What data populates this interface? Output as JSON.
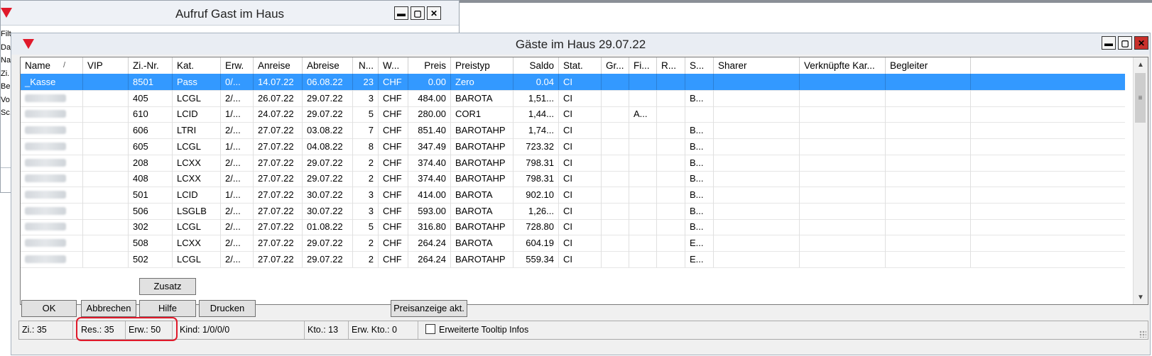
{
  "background_window": {
    "title": "Aufruf Gast im Haus",
    "side_labels": [
      "Filt",
      "Da",
      "Na",
      "Zi.",
      "Be",
      "Vo",
      "Sc."
    ]
  },
  "main_window": {
    "title": "Gäste im Haus 29.07.22"
  },
  "grid": {
    "columns": [
      "Name",
      "VIP",
      "Zi.-Nr.",
      "Kat.",
      "Erw.",
      "Anreise",
      "Abreise",
      "N...",
      "W...",
      "Preis",
      "Preistyp",
      "Saldo",
      "Stat.",
      "Gr...",
      "Fi...",
      "R...",
      "S...",
      "Sharer",
      "Verknüpfte Kar...",
      "Begleiter"
    ],
    "sort_indicator": "/",
    "rows": [
      {
        "name": "_Kasse",
        "vip": "",
        "zi": "8501",
        "kat": "Pass",
        "erw": "0/...",
        "anreise": "14.07.22",
        "abreise": "06.08.22",
        "n": "23",
        "w": "CHF",
        "preis": "0.00",
        "preistyp": "Zero",
        "saldo": "0.04",
        "stat": "CI",
        "gr": "",
        "fi": "",
        "r": "",
        "s": "",
        "selected": true
      },
      {
        "name": "",
        "vip": "",
        "zi": "405",
        "kat": "LCGL",
        "erw": "2/...",
        "anreise": "26.07.22",
        "abreise": "29.07.22",
        "n": "3",
        "w": "CHF",
        "preis": "484.00",
        "preistyp": "BAROTA",
        "saldo": "1,51...",
        "stat": "CI",
        "gr": "",
        "fi": "",
        "r": "",
        "s": "B..."
      },
      {
        "name": "",
        "vip": "",
        "zi": "610",
        "kat": "LCID",
        "erw": "1/...",
        "anreise": "24.07.22",
        "abreise": "29.07.22",
        "n": "5",
        "w": "CHF",
        "preis": "280.00",
        "preistyp": "COR1",
        "saldo": "1,44...",
        "stat": "CI",
        "gr": "",
        "fi": "A...",
        "r": "",
        "s": "",
        "dot": true
      },
      {
        "name": "",
        "vip": "",
        "zi": "606",
        "kat": "LTRI",
        "erw": "2/...",
        "anreise": "27.07.22",
        "abreise": "03.08.22",
        "n": "7",
        "w": "CHF",
        "preis": "851.40",
        "preistyp": "BAROTAHP",
        "saldo": "1,74...",
        "stat": "CI",
        "gr": "",
        "fi": "",
        "r": "",
        "s": "B..."
      },
      {
        "name": "",
        "vip": "",
        "zi": "605",
        "kat": "LCGL",
        "erw": "1/...",
        "anreise": "27.07.22",
        "abreise": "04.08.22",
        "n": "8",
        "w": "CHF",
        "preis": "347.49",
        "preistyp": "BAROTAHP",
        "saldo": "723.32",
        "stat": "CI",
        "gr": "",
        "fi": "",
        "r": "",
        "s": "B..."
      },
      {
        "name": "",
        "vip": "",
        "zi": "208",
        "kat": "LCXX",
        "erw": "2/...",
        "anreise": "27.07.22",
        "abreise": "29.07.22",
        "n": "2",
        "w": "CHF",
        "preis": "374.40",
        "preistyp": "BAROTAHP",
        "saldo": "798.31",
        "stat": "CI",
        "gr": "",
        "fi": "",
        "r": "",
        "s": "B..."
      },
      {
        "name": "",
        "vip": "",
        "zi": "408",
        "kat": "LCXX",
        "erw": "2/...",
        "anreise": "27.07.22",
        "abreise": "29.07.22",
        "n": "2",
        "w": "CHF",
        "preis": "374.40",
        "preistyp": "BAROTAHP",
        "saldo": "798.31",
        "stat": "CI",
        "gr": "",
        "fi": "",
        "r": "",
        "s": "B..."
      },
      {
        "name": "",
        "vip": "",
        "zi": "501",
        "kat": "LCID",
        "erw": "1/...",
        "anreise": "27.07.22",
        "abreise": "30.07.22",
        "n": "3",
        "w": "CHF",
        "preis": "414.00",
        "preistyp": "BAROTA",
        "saldo": "902.10",
        "stat": "CI",
        "gr": "",
        "fi": "",
        "r": "",
        "s": "B..."
      },
      {
        "name": "",
        "vip": "",
        "zi": "506",
        "kat": "LSGLB",
        "erw": "2/...",
        "anreise": "27.07.22",
        "abreise": "30.07.22",
        "n": "3",
        "w": "CHF",
        "preis": "593.00",
        "preistyp": "BAROTA",
        "saldo": "1,26...",
        "stat": "CI",
        "gr": "",
        "fi": "",
        "r": "",
        "s": "B..."
      },
      {
        "name": "",
        "vip": "",
        "zi": "302",
        "kat": "LCGL",
        "erw": "2/...",
        "anreise": "27.07.22",
        "abreise": "01.08.22",
        "n": "5",
        "w": "CHF",
        "preis": "316.80",
        "preistyp": "BAROTAHP",
        "saldo": "728.80",
        "stat": "CI",
        "gr": "",
        "fi": "",
        "r": "",
        "s": "B..."
      },
      {
        "name": "",
        "vip": "",
        "zi": "508",
        "kat": "LCXX",
        "erw": "2/...",
        "anreise": "27.07.22",
        "abreise": "29.07.22",
        "n": "2",
        "w": "CHF",
        "preis": "264.24",
        "preistyp": "BAROTA",
        "saldo": "604.19",
        "stat": "CI",
        "gr": "",
        "fi": "",
        "r": "",
        "s": "E...",
        "dot": true
      },
      {
        "name": "",
        "vip": "",
        "zi": "502",
        "kat": "LCGL",
        "erw": "2/...",
        "anreise": "27.07.22",
        "abreise": "29.07.22",
        "n": "2",
        "w": "CHF",
        "preis": "264.24",
        "preistyp": "BAROTAHP",
        "saldo": "559.34",
        "stat": "CI",
        "gr": "",
        "fi": "",
        "r": "",
        "s": "E...",
        "dot": true
      }
    ]
  },
  "buttons": {
    "zusatz": "Zusatz",
    "ok": "OK",
    "abbrechen": "Abbrechen",
    "hilfe": "Hilfe",
    "drucken": "Drucken",
    "preisanzeige": "Preisanzeige akt."
  },
  "status": {
    "zi": "Zi.: 35",
    "res": "Res.: 35",
    "erw": "Erw.: 50",
    "kind": "Kind: 1/0/0/0",
    "kto": "Kto.: 13",
    "erw_kto": "Erw. Kto.: 0",
    "tooltip_checkbox": "Erweiterte Tooltip Infos",
    "tooltip_checked": false
  },
  "colors": {
    "selection": "#3399ff",
    "highlight": "#e0192a",
    "logo": "#e0192a"
  }
}
